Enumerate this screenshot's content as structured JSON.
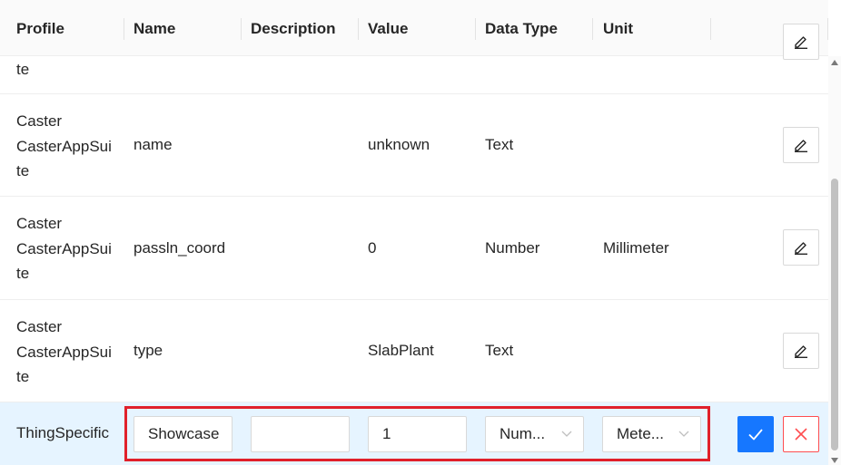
{
  "headers": {
    "profile": "Profile",
    "name": "Name",
    "description": "Description",
    "value": "Value",
    "data_type": "Data Type",
    "unit": "Unit"
  },
  "partial_row": {
    "profile": "te"
  },
  "rows": [
    {
      "profile": [
        "Caster",
        "CasterAppSui",
        "te"
      ],
      "name": "name",
      "description": "",
      "value": "unknown",
      "data_type": "Text",
      "unit": ""
    },
    {
      "profile": [
        "Caster",
        "CasterAppSui",
        "te"
      ],
      "name": "passln_coord",
      "description": "",
      "value": "0",
      "data_type": "Number",
      "unit": "Millimeter"
    },
    {
      "profile": [
        "Caster",
        "CasterAppSui",
        "te"
      ],
      "name": "type",
      "description": "",
      "value": "SlabPlant",
      "data_type": "Text",
      "unit": ""
    }
  ],
  "edit_row": {
    "profile": "ThingSpecific",
    "name_value": "Showcase",
    "description_value": "",
    "value_value": "1",
    "data_type_selected": "Num...",
    "unit_selected": "Mete..."
  },
  "colors": {
    "accent": "#1677ff",
    "edit_row_bg": "#e6f4ff",
    "highlight": "#e0202a",
    "danger": "#ff4d4f"
  },
  "icons": {
    "edit": "edit-icon",
    "check": "check-icon",
    "close": "close-icon",
    "dropdown": "chevron-down-icon"
  }
}
